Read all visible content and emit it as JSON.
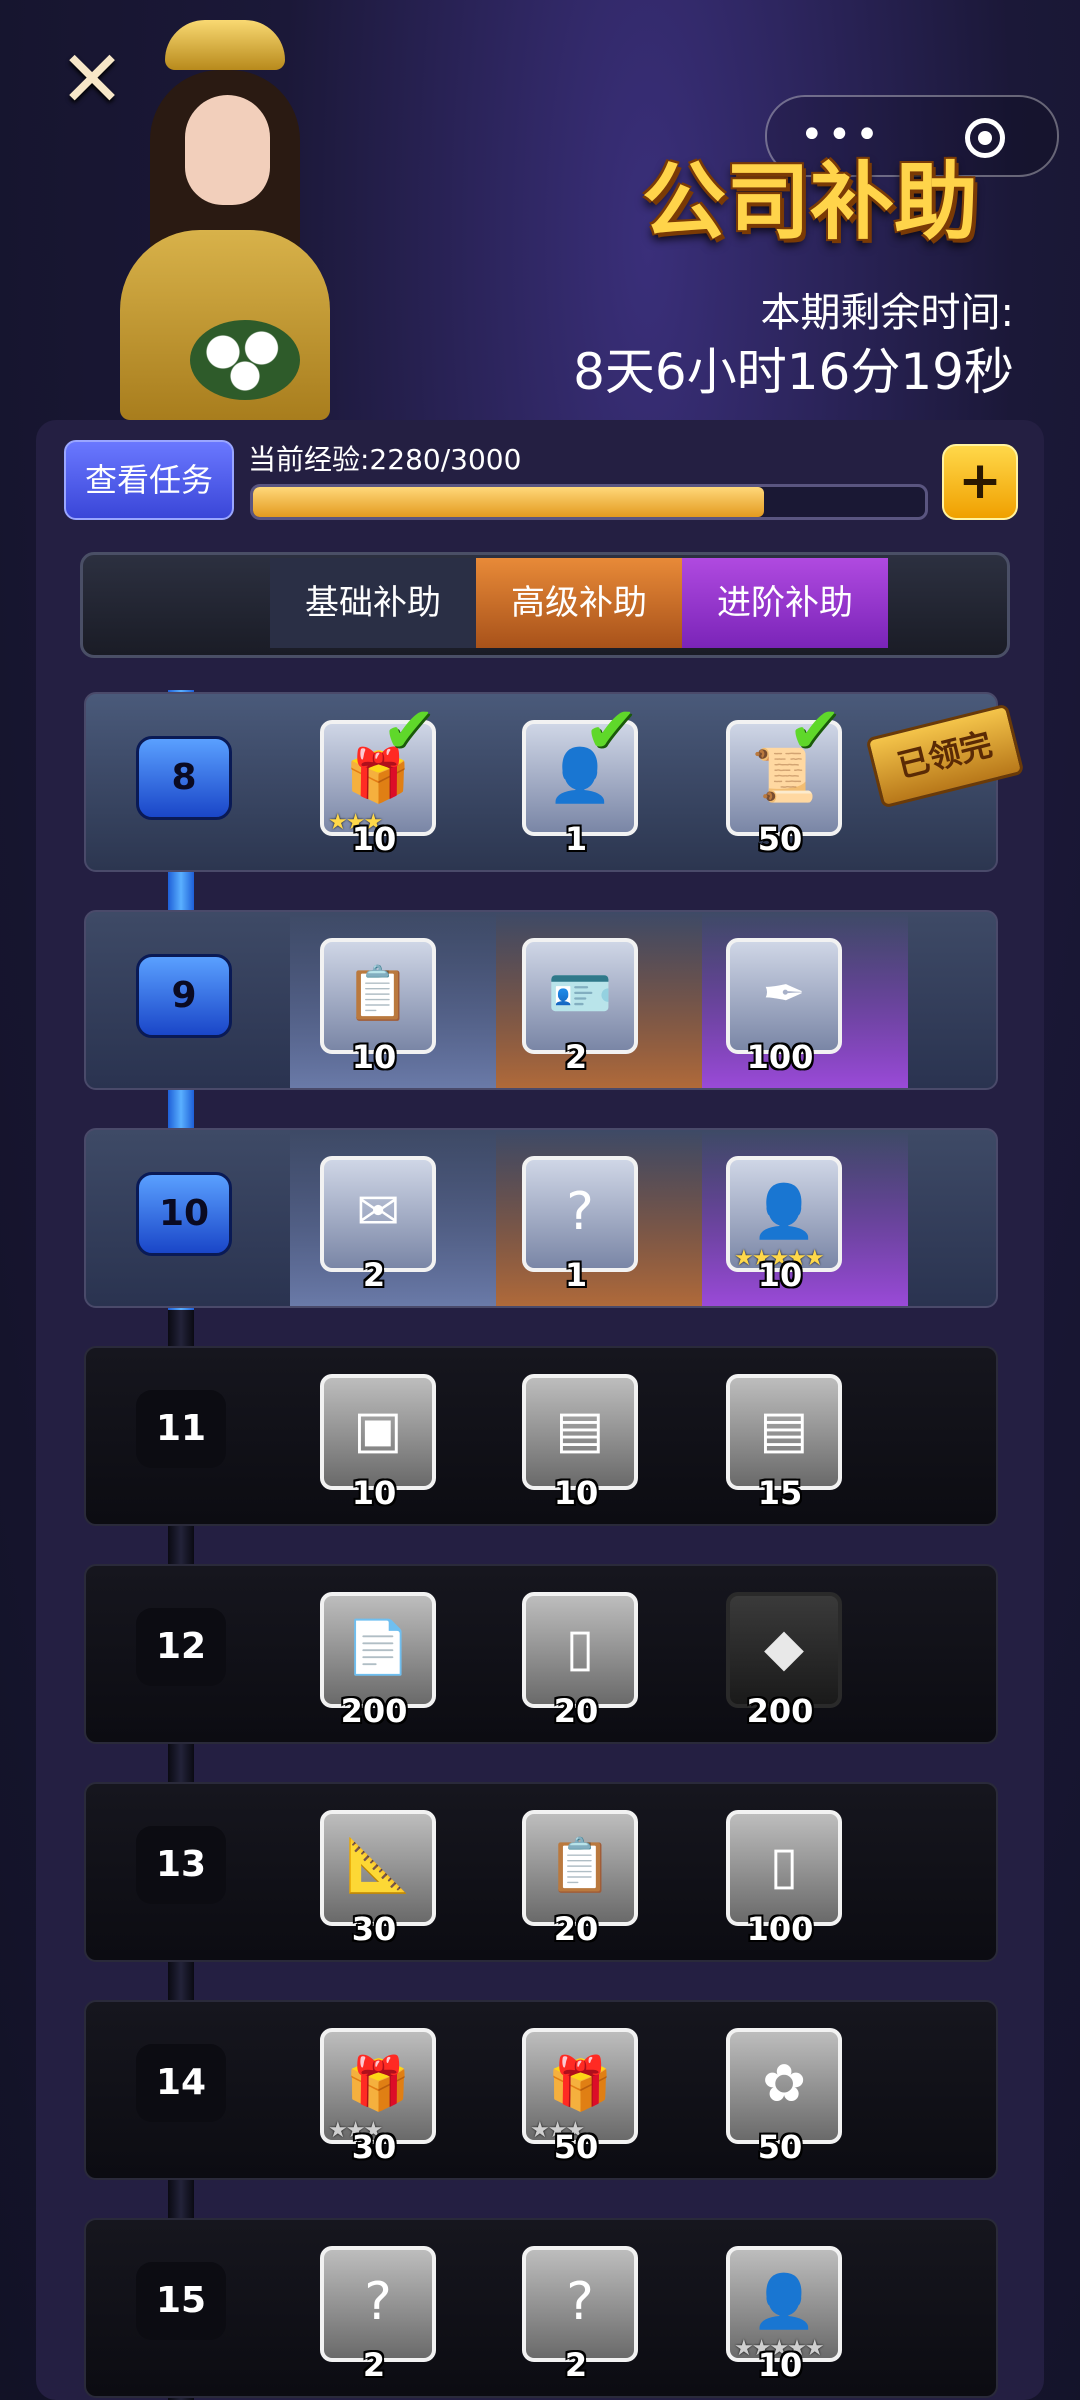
{
  "header": {
    "close_label": "✕",
    "menu_dots": "•••",
    "event_title": "公司补助",
    "time_label": "本期剩余时间:",
    "time_value": "8天6小时16分19秒"
  },
  "experience": {
    "task_button": "查看任务",
    "label": "当前经验:2280/3000",
    "current": 2280,
    "max": 3000,
    "plus_label": "+"
  },
  "tabs": [
    {
      "label": "基础补助"
    },
    {
      "label": "高级补助"
    },
    {
      "label": "进阶补助"
    }
  ],
  "claimed_stamp": "已领完",
  "colors": {
    "accent_gold": "#ffd44a",
    "track_active": "#3a8cff",
    "tab_advanced": "#e88a38",
    "tab_pro": "#b04ae0",
    "check": "#5fd82a"
  },
  "levels": [
    {
      "level": "8",
      "status": "claimed",
      "rewards": [
        {
          "icon": "gift-box-icon",
          "qty": "10",
          "claimed": true,
          "stars": 3
        },
        {
          "icon": "business-card-icon",
          "qty": "1",
          "claimed": true
        },
        {
          "icon": "work-permit-icon",
          "qty": "50",
          "claimed": true
        }
      ]
    },
    {
      "level": "9",
      "status": "active",
      "rewards": [
        {
          "icon": "contract-folder-icon",
          "qty": "10"
        },
        {
          "icon": "id-card-icon",
          "qty": "2"
        },
        {
          "icon": "ink-quill-icon",
          "qty": "100"
        }
      ]
    },
    {
      "level": "10",
      "status": "active",
      "rewards": [
        {
          "icon": "orange-envelope-icon",
          "qty": "2"
        },
        {
          "icon": "mystery-card-icon",
          "qty": "1"
        },
        {
          "icon": "artist-silhouette-icon",
          "qty": "10",
          "stars": 5
        }
      ]
    },
    {
      "level": "11",
      "status": "locked",
      "rewards": [
        {
          "icon": "seal-box-icon",
          "qty": "10"
        },
        {
          "icon": "paper-stack-icon",
          "qty": "10"
        },
        {
          "icon": "paper-stack-icon",
          "qty": "15"
        }
      ]
    },
    {
      "level": "12",
      "status": "locked",
      "rewards": [
        {
          "icon": "document-icon",
          "qty": "200"
        },
        {
          "icon": "photo-card-icon",
          "qty": "20"
        },
        {
          "icon": "diamond-icon",
          "qty": "200"
        }
      ]
    },
    {
      "level": "13",
      "status": "locked",
      "rewards": [
        {
          "icon": "blueprint-icon",
          "qty": "30"
        },
        {
          "icon": "contract-folder-icon",
          "qty": "20"
        },
        {
          "icon": "photo-card-icon",
          "qty": "100"
        }
      ]
    },
    {
      "level": "14",
      "status": "locked",
      "rewards": [
        {
          "icon": "gift-box-icon",
          "qty": "30",
          "stars": 3
        },
        {
          "icon": "gift-box-icon",
          "qty": "50",
          "stars": 3
        },
        {
          "icon": "puzzle-icon",
          "qty": "50"
        }
      ]
    },
    {
      "level": "15",
      "status": "locked",
      "rewards": [
        {
          "icon": "mystery-card-icon",
          "qty": "2"
        },
        {
          "icon": "mystery-card-icon",
          "qty": "2"
        },
        {
          "icon": "artist-silhouette-icon",
          "qty": "10",
          "stars": 5
        }
      ]
    }
  ]
}
